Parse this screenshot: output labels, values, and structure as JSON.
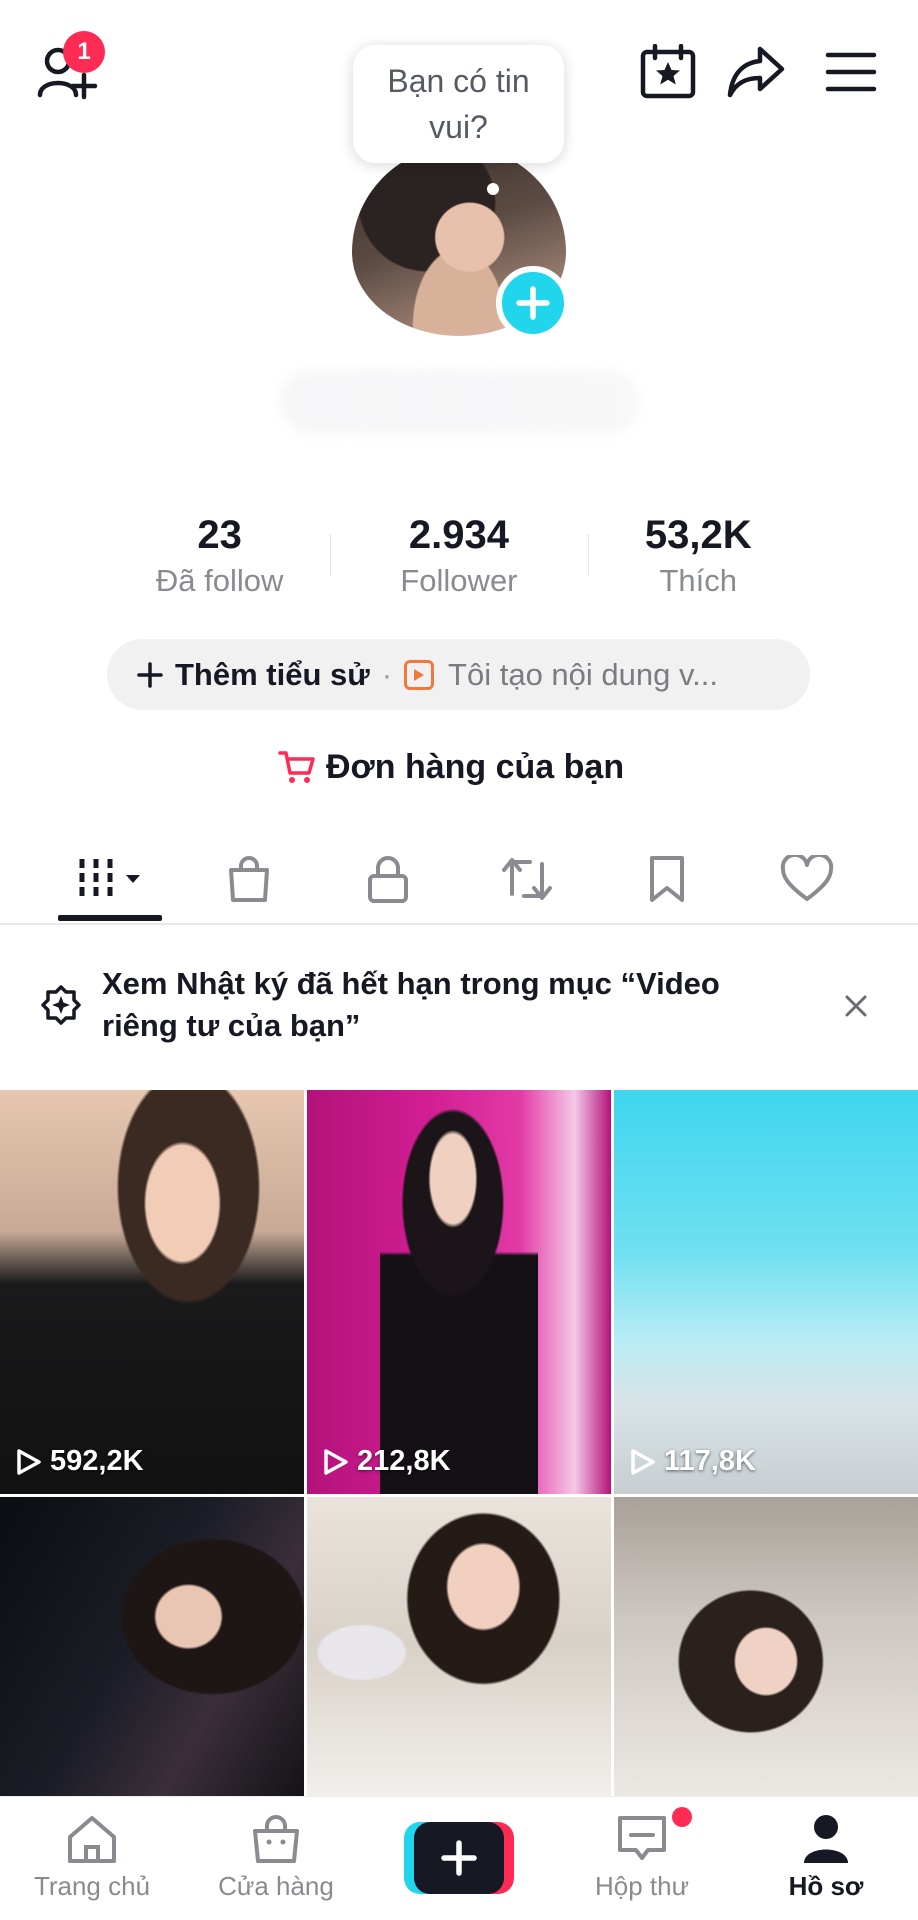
{
  "header": {
    "notification_count": "1",
    "status_bubble": "Bạn có tin vui?"
  },
  "stats": [
    {
      "value": "23",
      "label": "Đã follow"
    },
    {
      "value": "2.934",
      "label": "Follower"
    },
    {
      "value": "53,2K",
      "label": "Thích"
    }
  ],
  "bio": {
    "add_label": "Thêm tiểu sử",
    "separator": "·",
    "creator_label": "Tôi tạo nội dung v..."
  },
  "orders_label": "Đơn hàng của bạn",
  "tabs": [
    {
      "icon": "grid-icon"
    },
    {
      "icon": "shopping-bag-icon"
    },
    {
      "icon": "lock-icon"
    },
    {
      "icon": "repost-icon"
    },
    {
      "icon": "bookmark-icon"
    },
    {
      "icon": "heart-icon"
    }
  ],
  "notice": {
    "text": "Xem Nhật ký đã hết hạn trong mục “Video riêng tư của bạn”"
  },
  "videos": [
    {
      "views": "592,2K"
    },
    {
      "views": "212,8K"
    },
    {
      "views": "117,8K"
    },
    {
      "views": ""
    },
    {
      "views": ""
    },
    {
      "views": ""
    }
  ],
  "bottom_nav": {
    "home": "Trang chủ",
    "shop": "Cửa hàng",
    "inbox": "Hộp thư",
    "profile": "Hồ sơ"
  },
  "colors": {
    "accent_pink": "#fe2c55",
    "accent_cyan": "#20d5ec",
    "text_primary": "#161823",
    "text_secondary": "#8a8b91"
  }
}
